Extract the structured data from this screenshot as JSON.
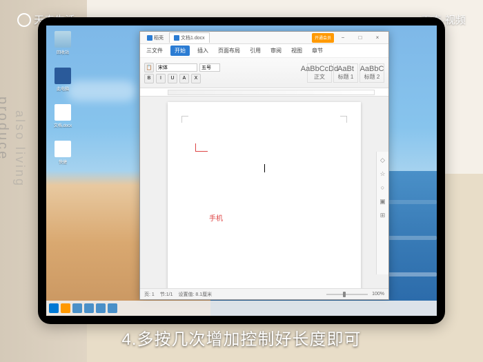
{
  "watermark": {
    "left": "天奇生活",
    "right": "天奇·视频"
  },
  "subtitle": "4.多按几次增加控制好长度即可",
  "desktop_icons": [
    {
      "label": "回收站"
    },
    {
      "label": "此电脑"
    },
    {
      "label": "文档.docx"
    },
    {
      "label": "快捷"
    }
  ],
  "window": {
    "tabs": [
      {
        "label": "稻壳",
        "active": false
      },
      {
        "label": "文档1.docx",
        "active": true
      }
    ],
    "vip_label": "开通会员",
    "menu": [
      "三文件",
      "开始",
      "插入",
      "页面布局",
      "引用",
      "审阅",
      "视图",
      "章节"
    ],
    "menu_active_index": 1,
    "font": {
      "name": "宋体",
      "size": "五号"
    },
    "format_buttons": [
      "B",
      "I",
      "U",
      "A",
      "X"
    ],
    "styles": [
      {
        "preview": "AaBbCcDd",
        "name": "正文"
      },
      {
        "preview": "AaBt",
        "name": "标题 1"
      },
      {
        "preview": "AaBbC",
        "name": "标题 2"
      }
    ],
    "document_text": "手机",
    "status": {
      "page": "页: 1",
      "section": "节:1/1",
      "pos": "设置值: 8.1厘米",
      "zoom": "100%"
    }
  },
  "backdrop_text": {
    "line1": "produce",
    "line2": "also living"
  }
}
